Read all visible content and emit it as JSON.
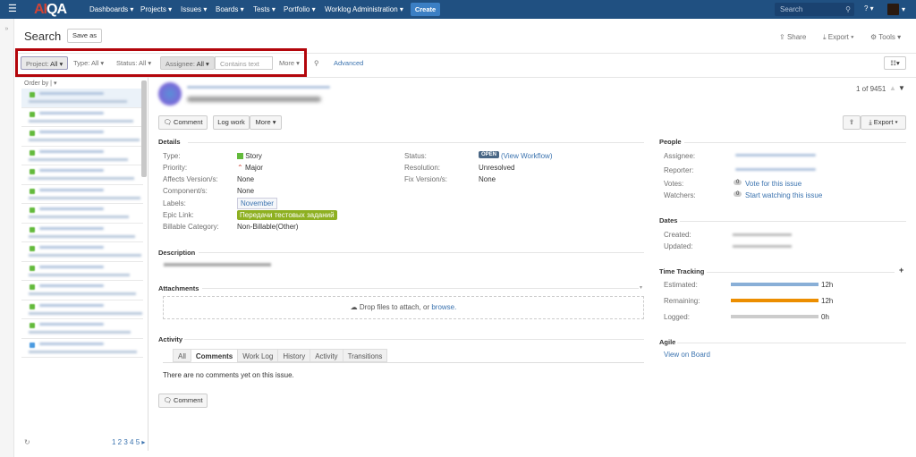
{
  "nav": {
    "logo": "AIQA",
    "menu": [
      "Dashboards ▾",
      "Projects ▾",
      "Issues ▾",
      "Boards ▾",
      "Tests ▾",
      "Portfolio ▾",
      "Worklog Administration ▾"
    ],
    "create": "Create",
    "search_placeholder": "Search",
    "help": "? ▾"
  },
  "header": {
    "title": "Search",
    "save_as": "Save as",
    "share": "Share",
    "export": "Export ▾",
    "tools": "Tools ▾"
  },
  "filters": {
    "project": "Project:",
    "project_val": "All ▾",
    "type": "Type: All ▾",
    "status": "Status: All ▾",
    "assignee": "Assignee:",
    "assignee_val": "All ▾",
    "contains_placeholder": "Contains text",
    "more": "More ▾",
    "advanced": "Advanced"
  },
  "list": {
    "order_by": "Order by",
    "pages": "1 2 3 4 5",
    "items": 14
  },
  "issue": {
    "counter": "1 of 9451",
    "comment": "Comment",
    "log_work": "Log work",
    "more": "More ▾",
    "export": "Export ▾"
  },
  "details": {
    "title": "Details",
    "type_l": "Type:",
    "type": "Story",
    "priority_l": "Priority:",
    "priority": "Major",
    "affects_l": "Affects Version/s:",
    "affects": "None",
    "components_l": "Component/s:",
    "components": "None",
    "labels_l": "Labels:",
    "labels": "November",
    "epic_l": "Epic Link:",
    "epic": "Передачи тестовых заданий",
    "billable_l": "Billable Category:",
    "billable": "Non-Billable(Other)",
    "status_l": "Status:",
    "status": "OPEN",
    "view_workflow": "(View Workflow)",
    "resolution_l": "Resolution:",
    "resolution": "Unresolved",
    "fix_l": "Fix Version/s:",
    "fix": "None"
  },
  "description": {
    "title": "Description"
  },
  "attachments": {
    "title": "Attachments",
    "drop": "Drop files to attach, or ",
    "browse": "browse."
  },
  "activity": {
    "title": "Activity",
    "tabs": [
      "All",
      "Comments",
      "Work Log",
      "History",
      "Activity",
      "Transitions"
    ],
    "active_tab": "Comments",
    "empty": "There are no comments yet on this issue.",
    "comment": "Comment"
  },
  "people": {
    "title": "People",
    "assignee_l": "Assignee:",
    "reporter_l": "Reporter:",
    "votes_l": "Votes:",
    "votes": "0",
    "vote_link": "Vote for this issue",
    "watchers_l": "Watchers:",
    "watchers": "0",
    "watch_link": "Start watching this issue"
  },
  "dates": {
    "title": "Dates",
    "created_l": "Created:",
    "updated_l": "Updated:"
  },
  "time": {
    "title": "Time Tracking",
    "plus": "+",
    "estimated_l": "Estimated:",
    "estimated": "12h",
    "remaining_l": "Remaining:",
    "remaining": "12h",
    "logged_l": "Logged:",
    "logged": "0h",
    "estimated_fraction": 1,
    "remaining_fraction": 1,
    "logged_fraction": 0
  },
  "agile": {
    "title": "Agile",
    "view_board": "View on Board"
  },
  "colors": {
    "nav": "#205081",
    "estimated": "#89afd7",
    "remaining": "#ec8e00",
    "logged": "#cccccc",
    "epic": "#8eb021",
    "status": "#4a6785",
    "highlight": "#b3050b"
  }
}
